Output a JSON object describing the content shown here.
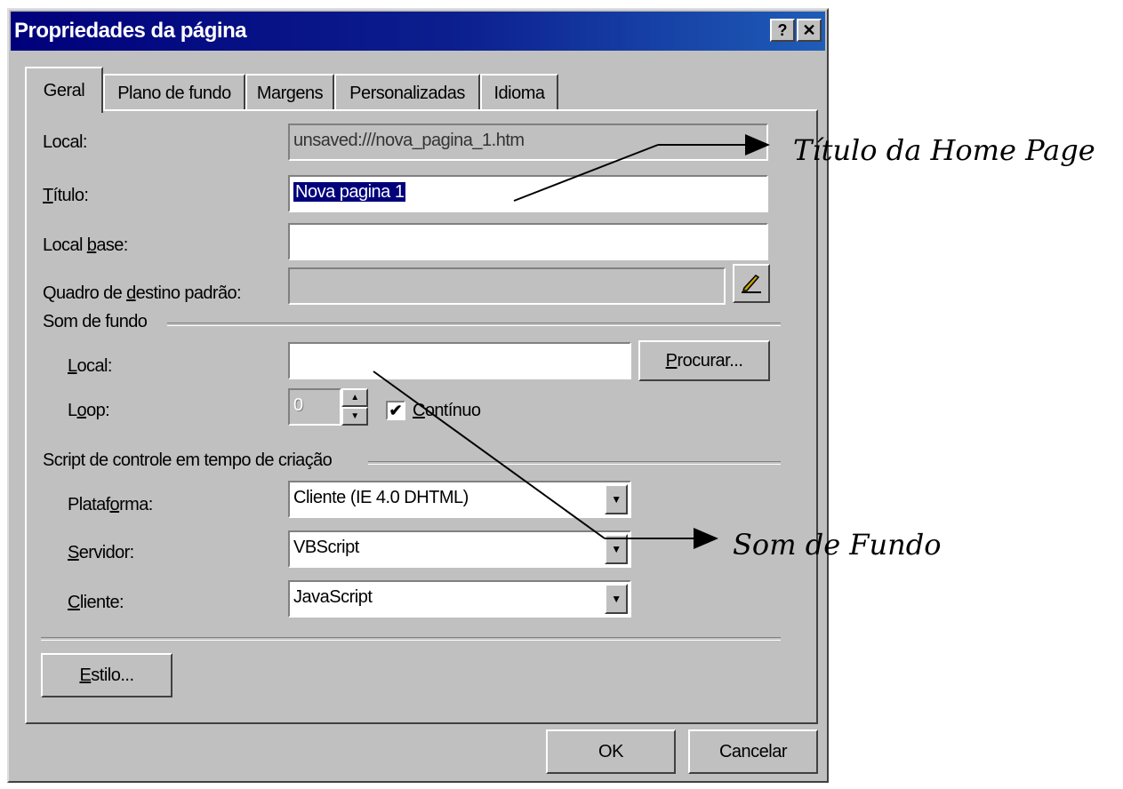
{
  "window": {
    "title": "Propriedades da página",
    "help_button": "?",
    "close_button": "✕"
  },
  "tabs": [
    {
      "label": "Geral",
      "active": true
    },
    {
      "label": "Plano de fundo",
      "active": false
    },
    {
      "label": "Margens",
      "active": false
    },
    {
      "label": "Personalizadas",
      "active": false
    },
    {
      "label": "Idioma",
      "active": false
    }
  ],
  "general": {
    "local_label": "Local:",
    "local_value": "unsaved:///nova_pagina_1.htm",
    "titulo_label_first": "T",
    "titulo_label_rest": "ítulo:",
    "titulo_value": "Nova pagina 1",
    "local_base_label_a": "Local ",
    "local_base_label_b": "b",
    "local_base_label_c": "ase:",
    "local_base_value": "",
    "quadro_label_a": "Quadro de ",
    "quadro_label_b": "d",
    "quadro_label_c": "estino padrão:",
    "quadro_value": ""
  },
  "som_de_fundo": {
    "group_label": "Som de fundo",
    "local_label_a": "L",
    "local_label_b": "ocal:",
    "local_value": "",
    "procurar_a": "P",
    "procurar_b": "rocurar...",
    "loop_label_a": "L",
    "loop_label_b": "o",
    "loop_label_c": "op:",
    "loop_value": "0",
    "continuo_label_a": "C",
    "continuo_label_b": "ontínuo",
    "continuo_checked": "✔"
  },
  "script": {
    "group_label": "Script de controle em tempo de criação",
    "plataforma_label_a": "Plataf",
    "plataforma_label_b": "o",
    "plataforma_label_c": "rma:",
    "plataforma_value": "Cliente (IE 4.0 DHTML)",
    "servidor_label_a": "S",
    "servidor_label_b": "ervidor:",
    "servidor_value": "VBScript",
    "cliente_label_a": "C",
    "cliente_label_b": "liente:",
    "cliente_value": "JavaScript",
    "dropdown_arrow": "▼"
  },
  "buttons": {
    "estilo_a": "E",
    "estilo_b": "stilo...",
    "ok": "OK",
    "cancelar": "Cancelar"
  },
  "annotations": {
    "titulo_home_page": "Título da Home Page",
    "som_de_fundo": "Som de Fundo"
  },
  "colors": {
    "titlebar_start": "#00007b",
    "titlebar_end": "#1f5db8",
    "face": "#c0c0c0",
    "selection": "#00007b"
  }
}
